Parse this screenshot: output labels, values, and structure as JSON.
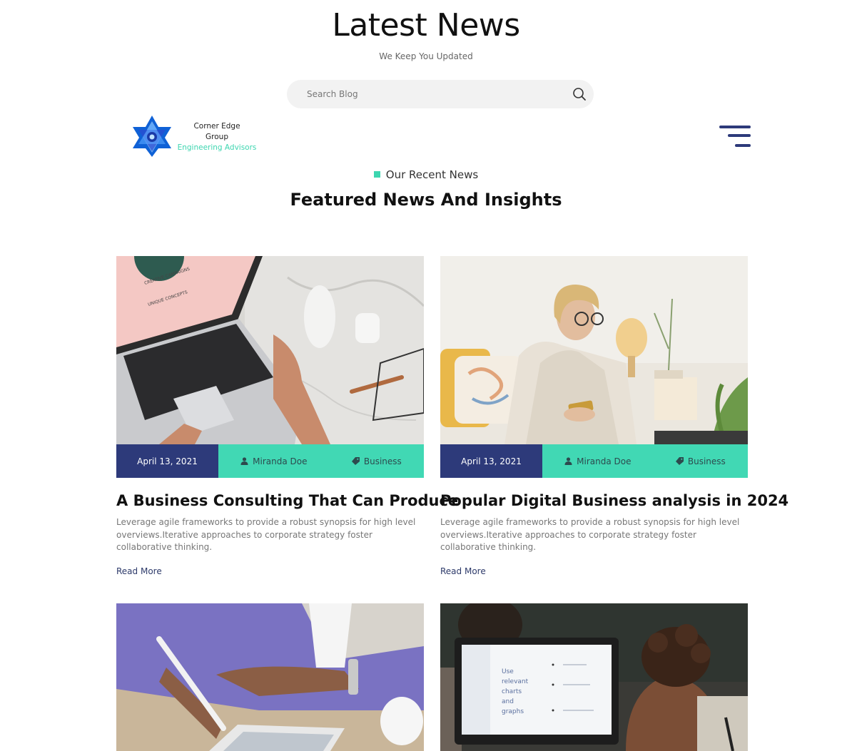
{
  "header": {
    "title": "Latest News",
    "subtitle": "We Keep You Updated"
  },
  "search": {
    "placeholder": "Search Blog",
    "value": ""
  },
  "brand": {
    "name_line1": "Corner Edge",
    "name_line2": "Group",
    "tagline": "Engineering Advisors"
  },
  "section": {
    "eyebrow": "Our Recent News",
    "title": "Featured News And Insights"
  },
  "colors": {
    "navy": "#2d3a7a",
    "teal": "#41d8b4",
    "accent": "#3dd6b0"
  },
  "icons": {
    "search": "search-icon",
    "menu": "hamburger-menu-icon",
    "author": "user-icon",
    "category": "tag-icon"
  },
  "posts": [
    {
      "date": "April 13, 2021",
      "author": "Miranda Doe",
      "category": "Business",
      "title": "A Business Consulting That Can Produce",
      "excerpt": "Leverage agile frameworks to provide a robust synopsis for high level overviews.Iterative approaches to corporate strategy foster collaborative thinking.",
      "read_more": "Read More"
    },
    {
      "date": "April 13, 2021",
      "author": "Miranda Doe",
      "category": "Business",
      "title": "Popular Digital Business analysis in 2024",
      "excerpt": "Leverage agile frameworks to provide a robust synopsis for high level overviews.Iterative approaches to corporate strategy foster collaborative thinking.",
      "read_more": "Read More"
    }
  ],
  "screen_text": {
    "words": [
      "Use",
      "relevant",
      "charts",
      "and",
      "graphs"
    ]
  }
}
